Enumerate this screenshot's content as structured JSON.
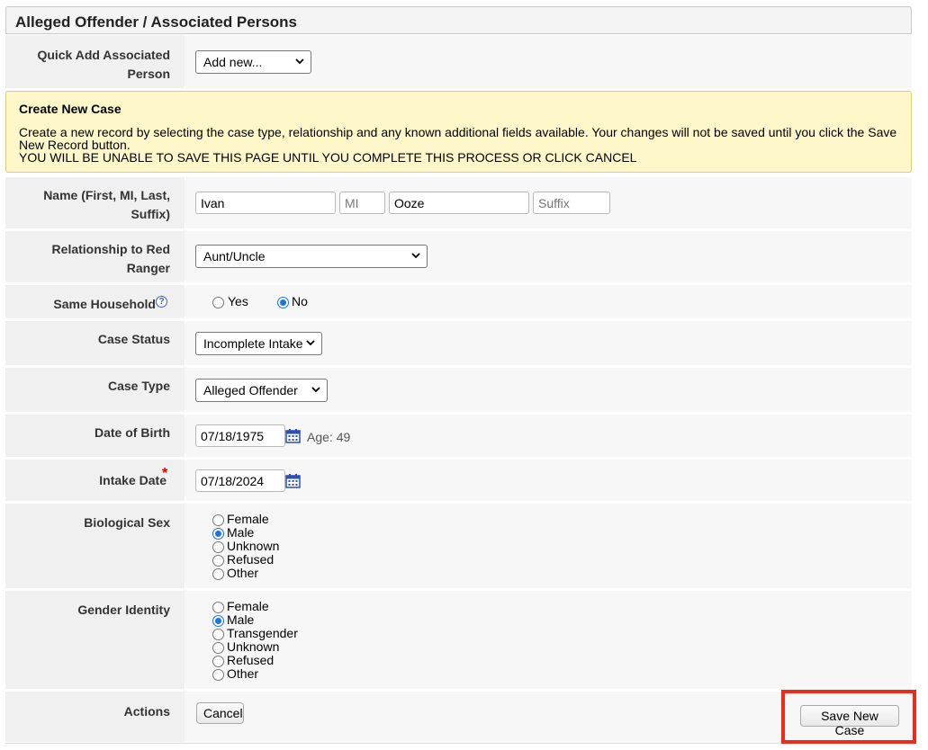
{
  "panel": {
    "title": "Alleged Offender / Associated Persons"
  },
  "quick_add": {
    "label": "Quick Add Associated Person",
    "selected": "Add new..."
  },
  "alert": {
    "title": "Create New Case",
    "line1": "Create a new record by selecting the case type, relationship and any known additional fields available. Your changes will not be saved until you click the Save New Record button.",
    "line2": "YOU WILL BE UNABLE TO SAVE THIS PAGE UNTIL YOU COMPLETE THIS PROCESS OR CLICK CANCEL"
  },
  "name": {
    "label": "Name (First, MI, Last, Suffix)",
    "first": "Ivan",
    "mi_placeholder": "MI",
    "last": "Ooze",
    "suffix_placeholder": "Suffix"
  },
  "relationship": {
    "label": "Relationship to Red Ranger",
    "selected": "Aunt/Uncle"
  },
  "household": {
    "label": "Same Household",
    "help_icon": "question-circle-icon",
    "options": [
      "Yes",
      "No"
    ],
    "selected": "No"
  },
  "case_status": {
    "label": "Case Status",
    "selected": "Incomplete Intake"
  },
  "case_type": {
    "label": "Case Type",
    "selected": "Alleged Offender"
  },
  "dob": {
    "label": "Date of Birth",
    "value": "07/18/1975",
    "age_text": "Age: 49",
    "icon": "calendar-icon"
  },
  "intake": {
    "label": "Intake Date",
    "required_mark": "*",
    "value": "07/18/2024",
    "icon": "calendar-icon"
  },
  "bio_sex": {
    "label": "Biological Sex",
    "options": [
      "Female",
      "Male",
      "Unknown",
      "Refused",
      "Other"
    ],
    "selected": "Male"
  },
  "gender": {
    "label": "Gender Identity",
    "options": [
      "Female",
      "Male",
      "Transgender",
      "Unknown",
      "Refused",
      "Other"
    ],
    "selected": "Male"
  },
  "actions": {
    "label": "Actions",
    "cancel": "Cancel",
    "save": "Save New Case"
  },
  "colors": {
    "highlight": "#ee2a1a",
    "alert_bg": "#fdf7c9",
    "radio_accent": "#1a73e8",
    "calendar": "#2b4fb5"
  }
}
